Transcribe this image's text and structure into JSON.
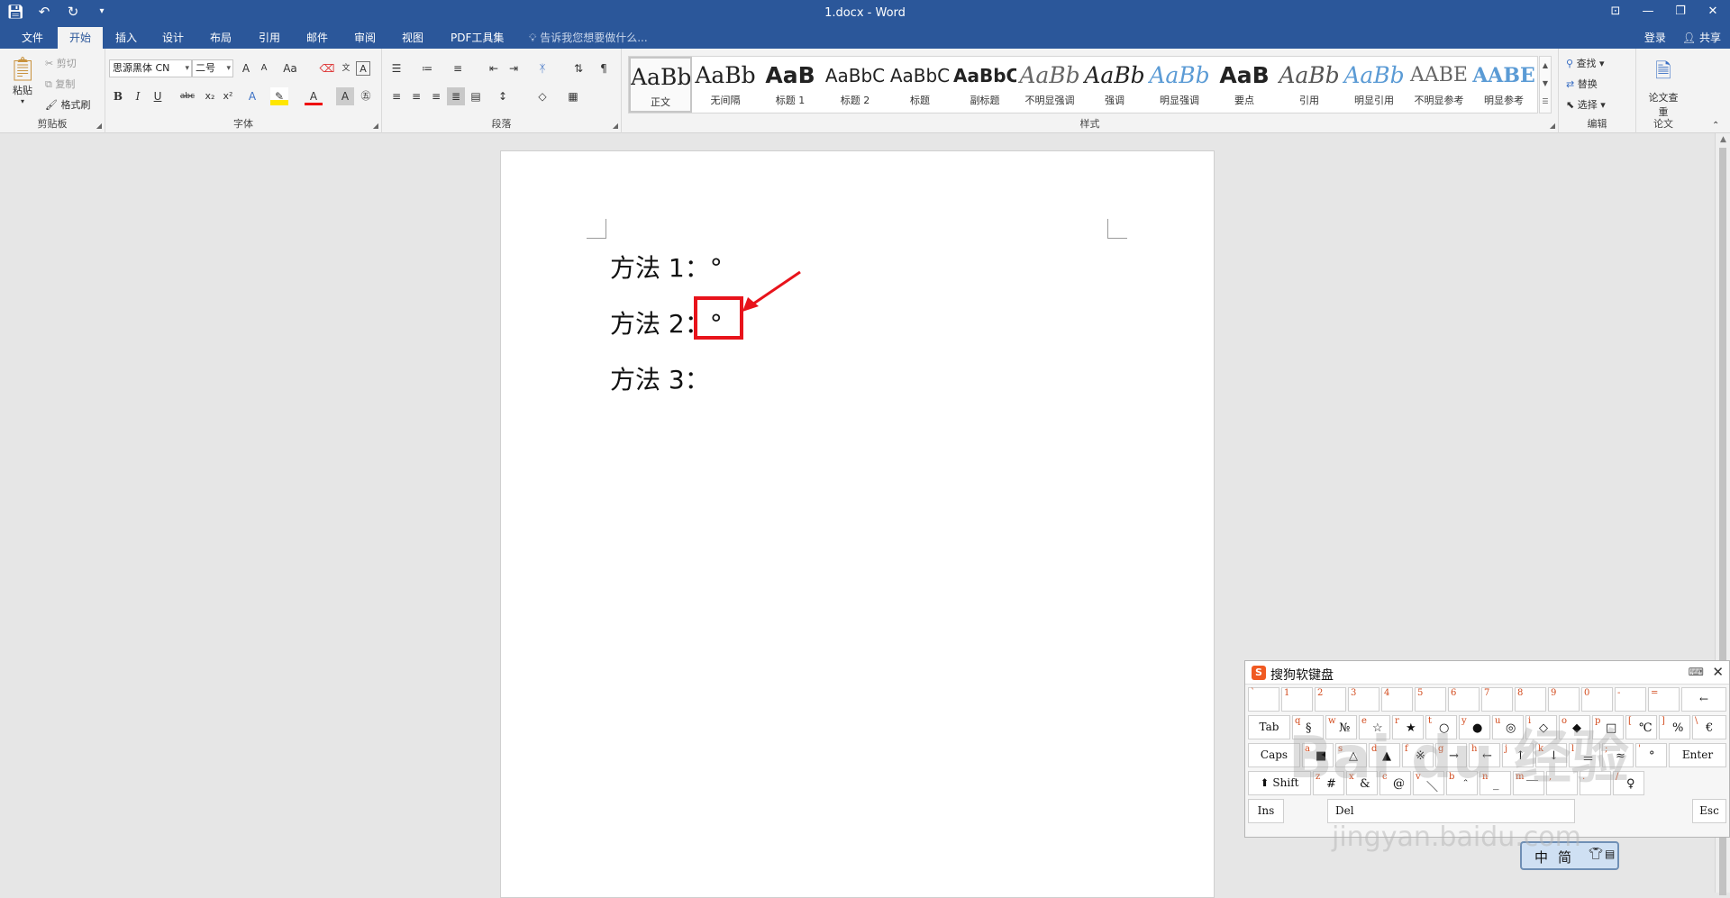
{
  "window": {
    "title": "1.docx - Word",
    "qat": {
      "save_icon": "save-icon",
      "undo_icon": "undo-icon",
      "redo_icon": "redo-icon",
      "customize_icon": "qat-customize-icon"
    },
    "controls": {
      "ribbon_display": "ribbon-display-icon",
      "minimize": "minimize-icon",
      "restore": "restore-icon",
      "close": "close-icon"
    }
  },
  "tabs": [
    "文件",
    "开始",
    "插入",
    "设计",
    "布局",
    "引用",
    "邮件",
    "审阅",
    "视图",
    "PDF工具集"
  ],
  "active_tab": "开始",
  "tell_me": "告诉我您想要做什么...",
  "account": {
    "login": "登录",
    "share": "共享"
  },
  "ribbon": {
    "clipboard": {
      "label": "剪贴板",
      "paste": "粘贴",
      "cut": "剪切",
      "copy": "复制",
      "format_painter": "格式刷"
    },
    "font": {
      "label": "字体",
      "font_name": "思源黑体 CN",
      "font_size": "二号",
      "grow": "A",
      "shrink": "A",
      "change_case": "Aa",
      "bold": "B",
      "italic": "I",
      "underline": "U",
      "strike": "abc",
      "subscript": "x₂",
      "superscript": "x²"
    },
    "paragraph": {
      "label": "段落"
    },
    "styles": {
      "label": "样式",
      "items": [
        {
          "sample": "AaBb",
          "name": "正文"
        },
        {
          "sample": "AaBb",
          "name": "无间隔"
        },
        {
          "sample": "AaB",
          "name": "标题 1"
        },
        {
          "sample": "AaBbC",
          "name": "标题 2"
        },
        {
          "sample": "AaBbC",
          "name": "标题"
        },
        {
          "sample": "AaBbC",
          "name": "副标题"
        },
        {
          "sample": "AaBb",
          "name": "不明显强调"
        },
        {
          "sample": "AaBb",
          "name": "强调"
        },
        {
          "sample": "AaBb",
          "name": "明显强调"
        },
        {
          "sample": "AaB",
          "name": "要点"
        },
        {
          "sample": "AaBb",
          "name": "引用"
        },
        {
          "sample": "AaBb",
          "name": "明显引用"
        },
        {
          "sample": "AABE",
          "name": "不明显参考"
        },
        {
          "sample": "AABE",
          "name": "明显参考"
        }
      ]
    },
    "editing": {
      "label": "编辑",
      "find": "查找",
      "replace": "替换",
      "select": "选择"
    },
    "paper": {
      "label": "论文",
      "check": "论文查重"
    }
  },
  "document": {
    "lines": [
      "方法 1：°",
      "方法 2：°",
      "方法 3："
    ]
  },
  "soft_keyboard": {
    "title": "搜狗软键盘",
    "rows": [
      [
        {
          "l": "`",
          "c": ""
        },
        {
          "l": "1",
          "c": ""
        },
        {
          "l": "2",
          "c": ""
        },
        {
          "l": "3",
          "c": ""
        },
        {
          "l": "4",
          "c": ""
        },
        {
          "l": "5",
          "c": ""
        },
        {
          "l": "6",
          "c": ""
        },
        {
          "l": "7",
          "c": ""
        },
        {
          "l": "8",
          "c": ""
        },
        {
          "l": "9",
          "c": ""
        },
        {
          "l": "0",
          "c": ""
        },
        {
          "l": "-",
          "c": ""
        },
        {
          "l": "=",
          "c": ""
        }
      ],
      [
        {
          "l": "q",
          "c": "§"
        },
        {
          "l": "w",
          "c": "№"
        },
        {
          "l": "e",
          "c": "☆"
        },
        {
          "l": "r",
          "c": "★"
        },
        {
          "l": "t",
          "c": "○"
        },
        {
          "l": "y",
          "c": "●"
        },
        {
          "l": "u",
          "c": "◎"
        },
        {
          "l": "i",
          "c": "◇"
        },
        {
          "l": "o",
          "c": "◆"
        },
        {
          "l": "p",
          "c": "□"
        },
        {
          "l": "[",
          "c": "℃"
        },
        {
          "l": "]",
          "c": "%"
        },
        {
          "l": "\\",
          "c": "€"
        }
      ],
      [
        {
          "l": "a",
          "c": "■"
        },
        {
          "l": "s",
          "c": "△"
        },
        {
          "l": "d",
          "c": "▲"
        },
        {
          "l": "f",
          "c": "※"
        },
        {
          "l": "g",
          "c": "→"
        },
        {
          "l": "h",
          "c": "←"
        },
        {
          "l": "j",
          "c": "↑"
        },
        {
          "l": "k",
          "c": "↓"
        },
        {
          "l": "l",
          "c": "＝"
        },
        {
          "l": ";",
          "c": "≈"
        },
        {
          "l": "'",
          "c": "°"
        }
      ],
      [
        {
          "l": "z",
          "c": "#"
        },
        {
          "l": "x",
          "c": "&"
        },
        {
          "l": "c",
          "c": "@"
        },
        {
          "l": "v",
          "c": "＼"
        },
        {
          "l": "b",
          "c": "＾"
        },
        {
          "l": "n",
          "c": "_"
        },
        {
          "l": "m",
          "c": "￣"
        },
        {
          "l": ",",
          "c": ""
        },
        {
          "l": ".",
          "c": ""
        },
        {
          "l": "/",
          "c": "♀"
        }
      ]
    ],
    "special": {
      "backspace": "←",
      "tab": "Tab",
      "caps": "Caps",
      "enter": "Enter",
      "shift": "Shift",
      "ins": "Ins",
      "del": "Del",
      "esc": "Esc"
    }
  },
  "ime_bar": {
    "mode": "中",
    "script": "简"
  },
  "watermark": {
    "text": "Bai du 经验",
    "url": "jingyan.baidu.com"
  }
}
